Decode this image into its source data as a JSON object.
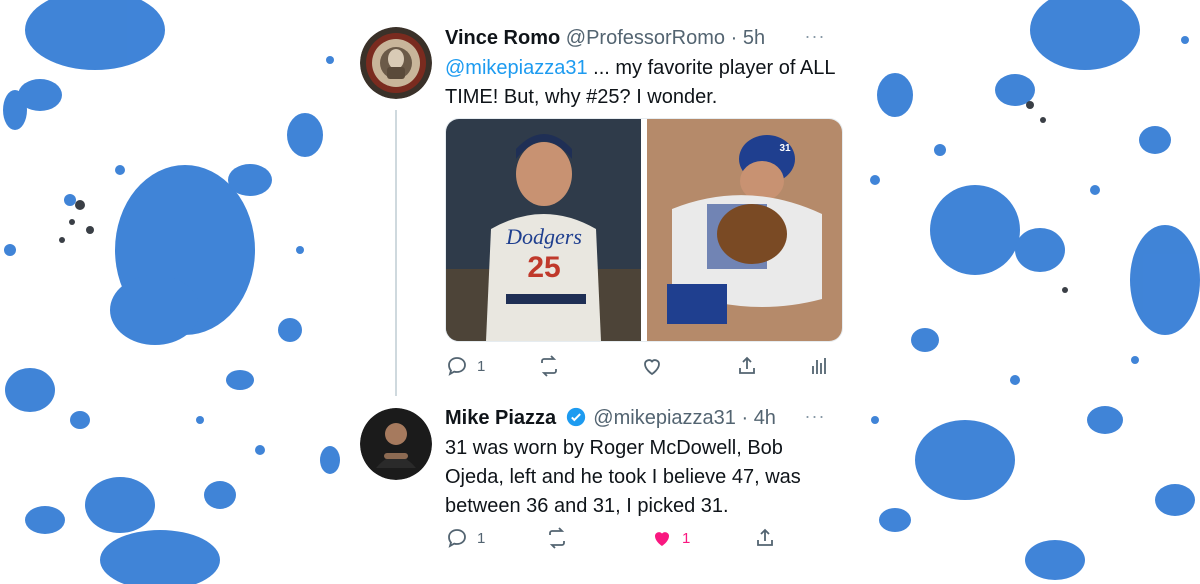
{
  "tweets": [
    {
      "name": "Vince Romo",
      "handle": "@ProfessorRomo",
      "separator": "·",
      "time": "5h",
      "more": "···",
      "mention": "@mikepiazza31",
      "text": " ... my favorite player of ALL TIME!  But, why #25?  I wonder.",
      "actions": {
        "reply_count": "1",
        "retweet_count": "",
        "like_count": ""
      }
    },
    {
      "name": "Mike Piazza",
      "handle": "@mikepiazza31",
      "separator": "·",
      "time": "4h",
      "more": "···",
      "text": "31 was worn by Roger McDowell, Bob Ojeda, left and he took I believe 47, was between 36 and 31, I picked 31.",
      "actions": {
        "reply_count": "1",
        "retweet_count": "",
        "like_count": "1"
      }
    }
  ],
  "photos": [
    {
      "jersey_word": "Dodgers",
      "jersey_number": "25"
    },
    {
      "helmet_number": "31"
    }
  ],
  "colors": {
    "accent": "#1d9bf0",
    "like": "#f91880",
    "splatter": "#1f6fd1",
    "text": "#0f1419",
    "muted": "#536471"
  }
}
